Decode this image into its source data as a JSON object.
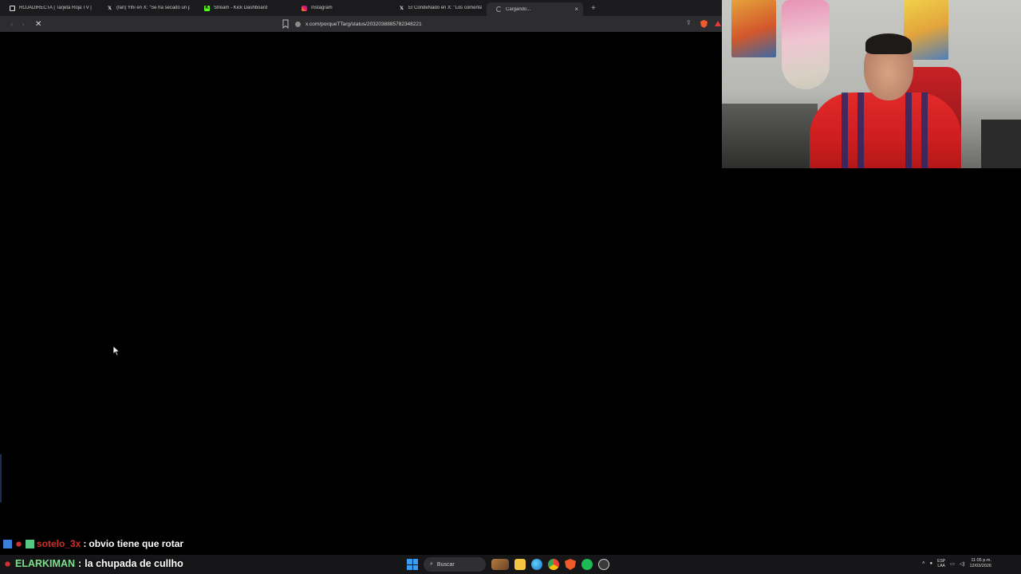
{
  "browser": {
    "tabs": [
      {
        "title": "ROJADIRECTA | Tarjeta Roja TV | Fútbol",
        "icon": "rojadirecta-icon",
        "active": false
      },
      {
        "title": "(fan) Yihi en X: \"Se ha secado un pozo",
        "icon": "x-icon",
        "active": false
      },
      {
        "title": "Stream - Kick Dashboard",
        "icon": "kick-icon",
        "active": false
      },
      {
        "title": "Instagram",
        "icon": "instagram-icon",
        "active": false
      },
      {
        "title": "El CondeNado en X: \"Los comentarios",
        "icon": "x-icon",
        "active": false
      },
      {
        "title": "Cargando...",
        "icon": "loading-icon",
        "active": true
      }
    ],
    "new_tab": "+",
    "close_tab": "×",
    "url": "x.com/porqueTTarg/status/2032038885782348221",
    "colors": {
      "tabstrip": "#1b1b1d",
      "toolbar": "#2d2d30",
      "page": "#000000"
    }
  },
  "chat": [
    {
      "user": "sotelo_3x",
      "separator": ":",
      "message": "obvio tiene que rotar",
      "user_color": "#d52b2b"
    },
    {
      "user": "ELARKIMAN",
      "separator": ":",
      "message": "la chupada de cullho",
      "user_color": "#7ee08c"
    }
  ],
  "taskbar": {
    "search_label": "Buscar",
    "lang_top": "ESP",
    "lang_bottom": "LAA",
    "time": "11:05 p.m.",
    "date": "12/03/2026"
  }
}
